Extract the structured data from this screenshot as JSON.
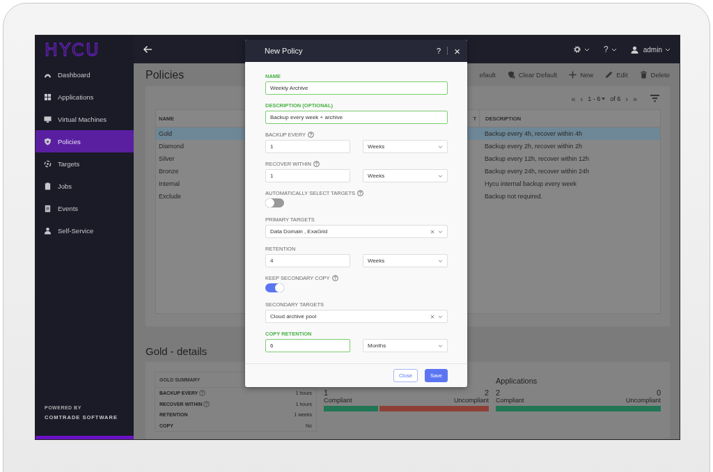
{
  "sidebar": {
    "logo": "HYCU",
    "items": [
      {
        "label": "Dashboard",
        "selected": false
      },
      {
        "label": "Applications",
        "selected": false
      },
      {
        "label": "Virtual Machines",
        "selected": false
      },
      {
        "label": "Policies",
        "selected": true
      },
      {
        "label": "Targets",
        "selected": false
      },
      {
        "label": "Jobs",
        "selected": false
      },
      {
        "label": "Events",
        "selected": false
      },
      {
        "label": "Self-Service",
        "selected": false
      }
    ],
    "footer": {
      "caption": "POWERED BY",
      "company": "COMTRADE SOFTWARE"
    }
  },
  "topbar": {
    "help": "?",
    "user": "admin"
  },
  "policies": {
    "title": "Policies",
    "toolbar": [
      {
        "label": "efault",
        "kind": "cut"
      },
      {
        "label": "Clear Default",
        "kind": "clear"
      },
      {
        "label": "New",
        "kind": "new"
      },
      {
        "label": "Edit",
        "kind": "edit"
      },
      {
        "label": "Delete",
        "kind": "delete"
      }
    ],
    "pager": {
      "first": "«",
      "prev": "‹",
      "range": "1 - 6",
      "total": "of 6",
      "next": "›",
      "last": "»"
    },
    "table": {
      "columns": [
        {
          "label": "NAME"
        },
        {
          "label": "T"
        },
        {
          "label": "DESCRIPTION"
        }
      ],
      "rows": [
        {
          "name": "Gold",
          "description": "Backup every 4h, recover within 4h",
          "selected": true
        },
        {
          "name": "Diamond",
          "description": "Backup every 2h, recover within 2h",
          "selected": false
        },
        {
          "name": "Silver",
          "description": "Backup every 12h, recover within 12h",
          "selected": false
        },
        {
          "name": "Bronze",
          "description": "Backup every 24h, recover within 24h",
          "selected": false
        },
        {
          "name": "Internal",
          "description": "Hycu internal backup every week",
          "selected": false
        },
        {
          "name": "Exclude",
          "description": "Backup not required.",
          "selected": false
        }
      ]
    }
  },
  "details": {
    "title": "Gold - details",
    "summary": {
      "heading": "GOLD SUMMARY",
      "rows": [
        {
          "label": "BACKUP EVERY",
          "help": true,
          "value": "1 hours"
        },
        {
          "label": "RECOVER WITHIN",
          "help": true,
          "value": "1 hours"
        },
        {
          "label": "RETENTION",
          "help": false,
          "value": "1 weeks"
        },
        {
          "label": "COPY",
          "help": false,
          "value": "No"
        }
      ]
    },
    "compliance": [
      {
        "compliant": "1",
        "compliant_label": "Compliant",
        "uncompliant": "2",
        "uncompliant_label": "Uncompliant",
        "level": 0.33
      },
      {
        "title": "Applications",
        "compliant": "2",
        "compliant_label": "Compliant",
        "uncompliant": "0",
        "uncompliant_label": "Uncompliant",
        "level": 1
      }
    ]
  },
  "dialog": {
    "title": "New Policy",
    "help": "?",
    "close": "×",
    "fields": [
      {
        "kind": "text",
        "label": "NAME",
        "value": "Weekly Archive",
        "valid": true,
        "help": false
      },
      {
        "kind": "text",
        "label": "DESCRIPTION (OPTIONAL)",
        "value": "Backup every week + archive",
        "valid": true,
        "help": false
      },
      {
        "kind": "amount",
        "label": "BACKUP EVERY",
        "value": "1",
        "unit": "Weeks",
        "valid": false,
        "help": true
      },
      {
        "kind": "amount",
        "label": "RECOVER WITHIN",
        "value": "1",
        "unit": "Weeks",
        "valid": false,
        "help": true
      },
      {
        "kind": "toggle",
        "label": "AUTOMATICALLY SELECT TARGETS",
        "on": false,
        "help": true
      },
      {
        "kind": "select",
        "label": "PRIMARY TARGETS",
        "value": "Data Domain , ExaGrid",
        "valid": false,
        "help": false
      },
      {
        "kind": "amount",
        "label": "RETENTION",
        "value": "4",
        "unit": "Weeks",
        "valid": false,
        "help": false
      },
      {
        "kind": "toggle",
        "label": "KEEP SECONDARY COPY",
        "on": true,
        "help": true
      },
      {
        "kind": "select",
        "label": "SECONDARY TARGETS",
        "value": "Cloud archive pool",
        "valid": false,
        "help": false
      },
      {
        "kind": "amount",
        "label": "COPY RETENTION",
        "value": "6",
        "unit": "Months",
        "valid": true,
        "help": false
      }
    ],
    "buttons": [
      {
        "label": "Close",
        "kind": "secondary"
      },
      {
        "label": "Save",
        "kind": "primary"
      }
    ]
  }
}
